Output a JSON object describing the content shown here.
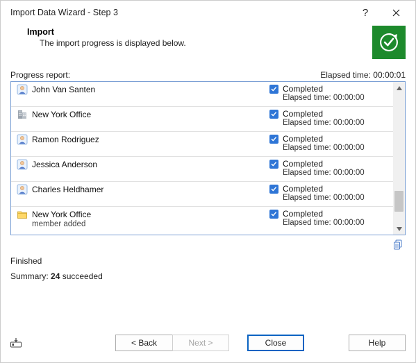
{
  "title": "Import Data Wizard - Step 3",
  "header": {
    "title": "Import",
    "subtitle": "The import progress is displayed below."
  },
  "progress": {
    "label": "Progress report:",
    "elapsed_label": "Elapsed time:",
    "elapsed_value": "00:00:01"
  },
  "items": [
    {
      "icon": "person",
      "name": "John Van Santen",
      "status": "Completed",
      "elapsed": "Elapsed time: 00:00:00"
    },
    {
      "icon": "building",
      "name": "New York Office",
      "status": "Completed",
      "elapsed": "Elapsed time: 00:00:00"
    },
    {
      "icon": "person",
      "name": "Ramon Rodriguez",
      "status": "Completed",
      "elapsed": "Elapsed time: 00:00:00"
    },
    {
      "icon": "person",
      "name": "Jessica Anderson",
      "status": "Completed",
      "elapsed": "Elapsed time: 00:00:00"
    },
    {
      "icon": "person",
      "name": "Charles Heldhamer",
      "status": "Completed",
      "elapsed": "Elapsed time: 00:00:00"
    },
    {
      "icon": "folder",
      "name": "New York Office",
      "sub": "member added",
      "status": "Completed",
      "elapsed": "Elapsed time: 00:00:00"
    }
  ],
  "finished": "Finished",
  "summary": {
    "prefix": "Summary: ",
    "count": "24",
    "word": " succeeded"
  },
  "buttons": {
    "back": "< Back",
    "next": "Next >",
    "close": "Close",
    "help": "Help"
  }
}
